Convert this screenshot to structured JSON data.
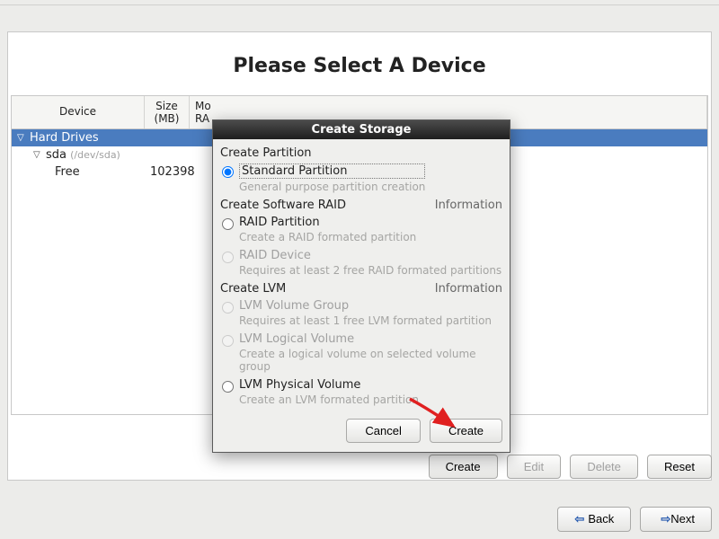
{
  "heading": "Please Select A Device",
  "columns": {
    "device": "Device",
    "size": "Size\n(MB)",
    "mount_raid": "Mo\nRA"
  },
  "tree": {
    "group_label": "Hard Drives",
    "disk_name": "sda",
    "disk_path": "(/dev/sda)",
    "free_label": "Free",
    "free_size": "102398"
  },
  "actions": {
    "create": "Create",
    "edit": "Edit",
    "delete": "Delete",
    "reset": "Reset",
    "back": "Back",
    "next": "Next"
  },
  "dialog": {
    "title": "Create Storage",
    "sec_partition": "Create Partition",
    "opt_standard": "Standard Partition",
    "opt_standard_hint": "General purpose partition creation",
    "sec_raid": "Create Software RAID",
    "info_label": "Information",
    "opt_raid_part": "RAID Partition",
    "opt_raid_part_hint": "Create a RAID formated partition",
    "opt_raid_dev": "RAID Device",
    "opt_raid_dev_hint": "Requires at least 2 free RAID formated partitions",
    "sec_lvm": "Create LVM",
    "opt_lvm_vg": "LVM Volume Group",
    "opt_lvm_vg_hint": "Requires at least 1 free LVM formated partition",
    "opt_lvm_lv": "LVM Logical Volume",
    "opt_lvm_lv_hint": "Create a logical volume on selected volume group",
    "opt_lvm_pv": "LVM Physical Volume",
    "opt_lvm_pv_hint": "Create an LVM formated partition",
    "cancel": "Cancel",
    "create": "Create"
  }
}
